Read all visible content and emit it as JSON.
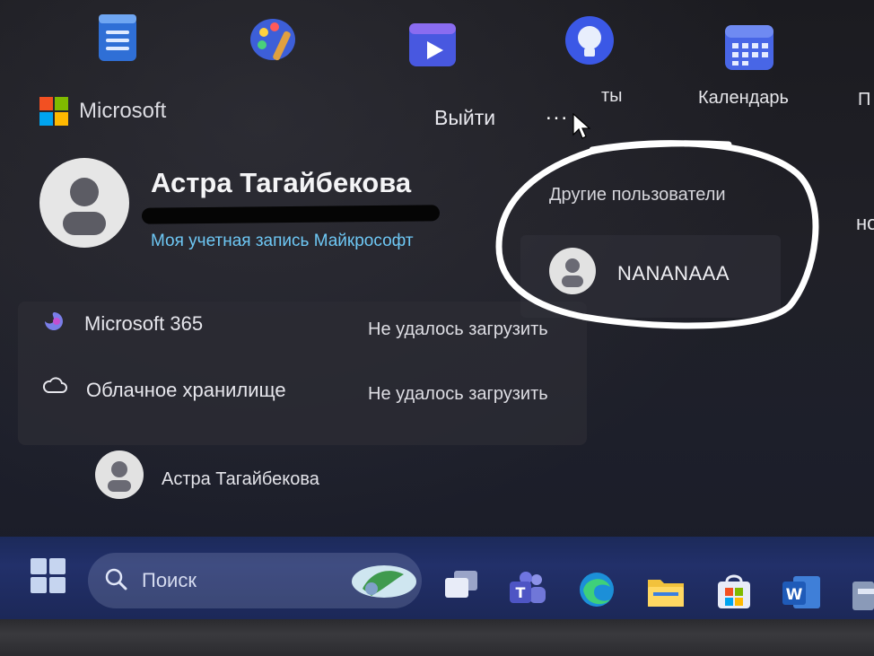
{
  "apps": {
    "partial_label_1": "ты",
    "calendar_label": "Календарь",
    "partial_label_2": "П"
  },
  "brand": {
    "name": "Microsoft"
  },
  "menu": {
    "sign_out": "Выйти",
    "more": "..."
  },
  "account": {
    "user_name": "Астра Тагайбекова",
    "account_link": "Моя учетная запись Майкрософт"
  },
  "services": [
    {
      "label": "Microsoft 365",
      "status": "Не удалось загрузить",
      "icon": "microsoft-365-icon"
    },
    {
      "label": "Облачное хранилище",
      "status": "Не удалось загрузить",
      "icon": "cloud-icon"
    }
  ],
  "other_users": {
    "title": "Другие пользователи",
    "users": [
      {
        "name": "NANANAAA"
      }
    ]
  },
  "bottom_user": {
    "name": "Астра Тагайбекова"
  },
  "right_edge": {
    "partial_text": "но"
  },
  "taskbar": {
    "search_placeholder": "Поиск",
    "icons": [
      "windows-start-icon",
      "search-icon",
      "task-view-icon",
      "teams-icon",
      "edge-icon",
      "file-explorer-icon",
      "microsoft-store-icon",
      "word-icon"
    ]
  },
  "colors": {
    "accent_link": "#6ec8f5",
    "taskbar": "#22306a",
    "annotation": "#ffffff"
  }
}
